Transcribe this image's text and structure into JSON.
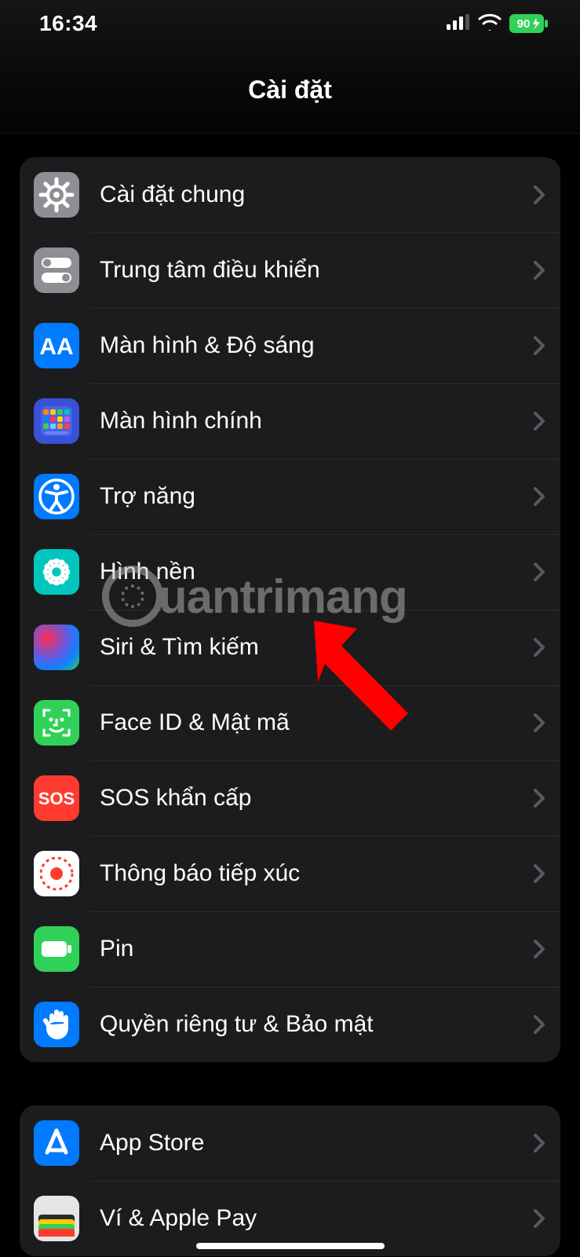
{
  "status": {
    "time": "16:34",
    "battery": "90"
  },
  "header": {
    "title": "Cài đặt"
  },
  "groups": [
    {
      "id": "g1",
      "items": [
        {
          "id": "general",
          "label": "Cài đặt chung",
          "icon": "gear",
          "bg": "#8e8e93"
        },
        {
          "id": "controlctr",
          "label": "Trung tâm điều khiển",
          "icon": "switches",
          "bg": "#8e8e93"
        },
        {
          "id": "display",
          "label": "Màn hình & Độ sáng",
          "icon": "aa",
          "bg": "#007aff"
        },
        {
          "id": "homescreen",
          "label": "Màn hình chính",
          "icon": "homescreen",
          "bg": "#3751d7"
        },
        {
          "id": "accessibility",
          "label": "Trợ năng",
          "icon": "accessibility",
          "bg": "#007aff"
        },
        {
          "id": "wallpaper",
          "label": "Hình nền",
          "icon": "wallpaper",
          "bg": "#00c7be"
        },
        {
          "id": "siri",
          "label": "Siri & Tìm kiếm",
          "icon": "siri",
          "bg": "siri"
        },
        {
          "id": "faceid",
          "label": "Face ID & Mật mã",
          "icon": "faceid",
          "bg": "#30d158"
        },
        {
          "id": "sos",
          "label": "SOS khẩn cấp",
          "icon": "sos",
          "bg": "#ff3b30"
        },
        {
          "id": "exposure",
          "label": "Thông báo tiếp xúc",
          "icon": "exposure",
          "bg": "#ffffff"
        },
        {
          "id": "battery",
          "label": "Pin",
          "icon": "battery",
          "bg": "#30d158"
        },
        {
          "id": "privacy",
          "label": "Quyền riêng tư & Bảo mật",
          "icon": "hand",
          "bg": "#007aff"
        }
      ]
    },
    {
      "id": "g2",
      "items": [
        {
          "id": "appstore",
          "label": "App Store",
          "icon": "appstore",
          "bg": "#007aff"
        },
        {
          "id": "wallet",
          "label": "Ví & Apple Pay",
          "icon": "wallet",
          "bg": "#e5e5e5"
        }
      ]
    }
  ],
  "watermark": {
    "text": "uantrimang"
  }
}
